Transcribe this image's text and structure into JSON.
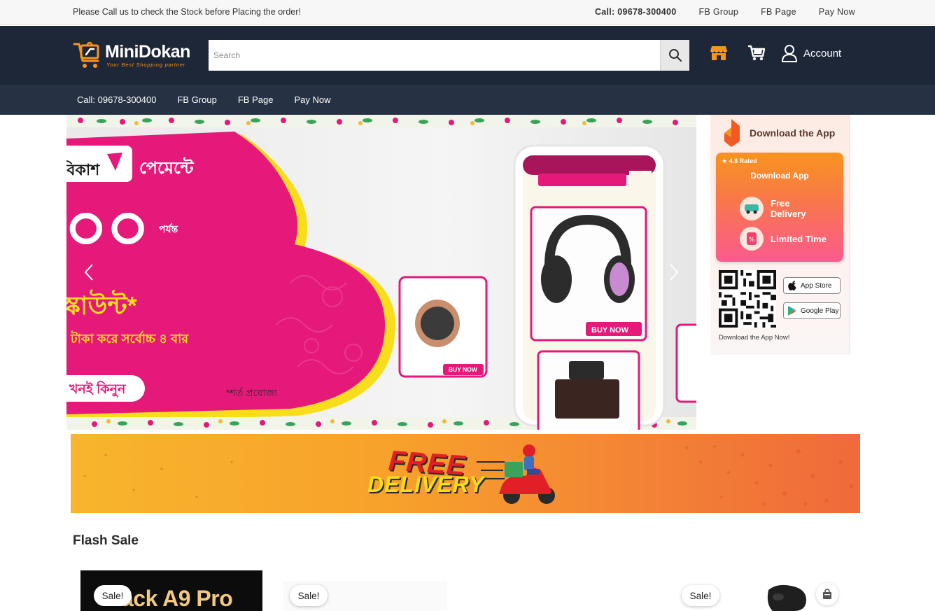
{
  "topbar": {
    "notice": "Please Call us to check the Stock before Placing the order!",
    "links": [
      "Call: 09678-300400",
      "FB Group",
      "FB Page",
      "Pay Now"
    ]
  },
  "header": {
    "logo_text": "MiniDokan",
    "logo_tagline": "Your Best Shopping partner",
    "search_placeholder": "Search",
    "search_value": "",
    "account_label": "Account"
  },
  "nav": {
    "links": [
      "Call: 09678-300400",
      "FB Group",
      "FB Page",
      "Pay Now"
    ]
  },
  "hero": {
    "brand": "বিকাশ",
    "payment": "পেমেন্টে",
    "amount": "০০",
    "upto": "পর্যন্ত",
    "discount": "স্কাউন্ট*",
    "subline": "টাকা করে সর্বোচ্চ ৪ বার",
    "cta": "খনই কিনুন",
    "terms": "*শর্ত প্রযোজ্য",
    "buy_now": "BUY NOW",
    "buy_now_small": "BUY NOW"
  },
  "app_promo": {
    "title": "Download the App",
    "rated": "★ 4.8 Rated",
    "download": "Download App",
    "feature1": "Free Delivery",
    "feature2": "Limited Time",
    "app_store": "App Store",
    "google_play": "Google Play",
    "footer": "Download the App Now!"
  },
  "delivery_banner": {
    "line1": "FREE",
    "line2": "DELIVERY"
  },
  "flash_sale": {
    "title": "Flash Sale",
    "badge": "Sale!",
    "product1_text": "ack A9 Pro"
  },
  "colors": {
    "header_bg": "#1e2738",
    "nav_bg": "#263143",
    "brand_orange": "#f7931e",
    "hero_pink": "#e5197a"
  }
}
